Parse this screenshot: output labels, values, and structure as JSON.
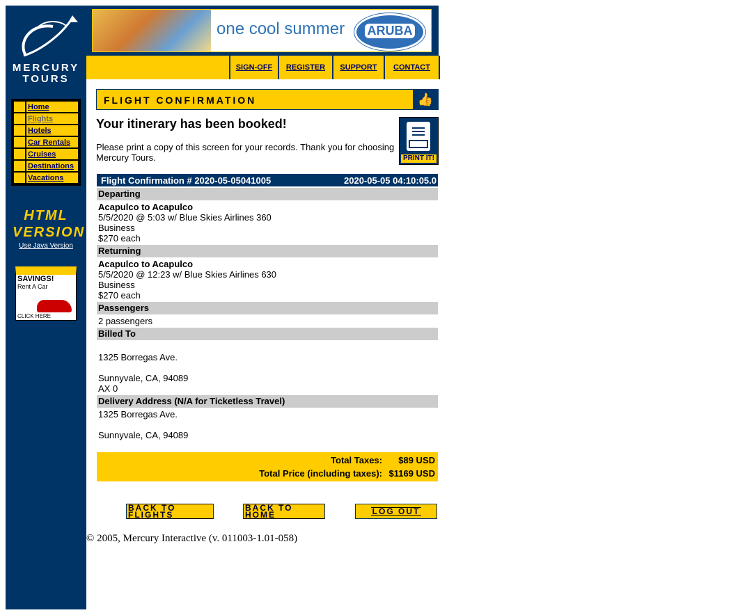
{
  "sidebar": {
    "logo_text": "MERCURY TOURS",
    "nav": [
      {
        "label": "Home"
      },
      {
        "label": "Flights"
      },
      {
        "label": "Hotels"
      },
      {
        "label": "Car Rentals"
      },
      {
        "label": "Cruises"
      },
      {
        "label": "Destinations"
      },
      {
        "label": "Vacations"
      }
    ],
    "html_version_badge": "HTML VERSION",
    "java_link": "Use Java Version",
    "savings_ad": {
      "line1": "SAVINGS!",
      "line2": "Rent A Car",
      "line3": "CLICK HERE"
    }
  },
  "banner": {
    "text": "one cool summer",
    "brand": "ARUBA"
  },
  "topnav": {
    "signoff": "SIGN-OFF",
    "register": "REGISTER",
    "support": "SUPPORT",
    "contact": "CONTACT"
  },
  "page": {
    "heading": "FLIGHT CONFIRMATION",
    "booked": "Your itinerary has been booked!",
    "print_message": "Please print a copy of this screen for your records. Thank you for choosing Mercury Tours.",
    "print_button": "PRINT IT!"
  },
  "confirmation": {
    "number_label": "Flight Confirmation # 2020-05-05041005",
    "timestamp": "2020-05-05 04:10:05.0",
    "departing_header": "Departing",
    "departing": {
      "route": "Acapulco to Acapulco",
      "details": "5/5/2020 @ 5:03 w/ Blue Skies Airlines 360",
      "class": "Business",
      "price": "$270 each"
    },
    "returning_header": "Returning",
    "returning": {
      "route": "Acapulco to Acapulco",
      "details": "5/5/2020 @ 12:23 w/ Blue Skies Airlines 630",
      "class": "Business",
      "price": "$270 each"
    },
    "passengers_header": "Passengers",
    "passengers": "2 passengers",
    "billed_header": "Billed To",
    "billed": {
      "street": "1325 Borregas Ave.",
      "city": "Sunnyvale, CA, 94089",
      "card": "AX 0"
    },
    "delivery_header": "Delivery Address (N/A for Ticketless Travel)",
    "delivery": {
      "street": "1325 Borregas Ave.",
      "city": "Sunnyvale, CA, 94089"
    }
  },
  "totals": {
    "taxes_label": "Total Taxes:",
    "taxes_value": "$89 USD",
    "price_label": "Total Price (including taxes):",
    "price_value": "$1169 USD"
  },
  "buttons": {
    "back_flights": "BACK TO FLIGHTS",
    "back_home": "BACK TO HOME",
    "logout": "LOG OUT"
  },
  "footer": "© 2005, Mercury Interactive (v. 011003-1.01-058)"
}
